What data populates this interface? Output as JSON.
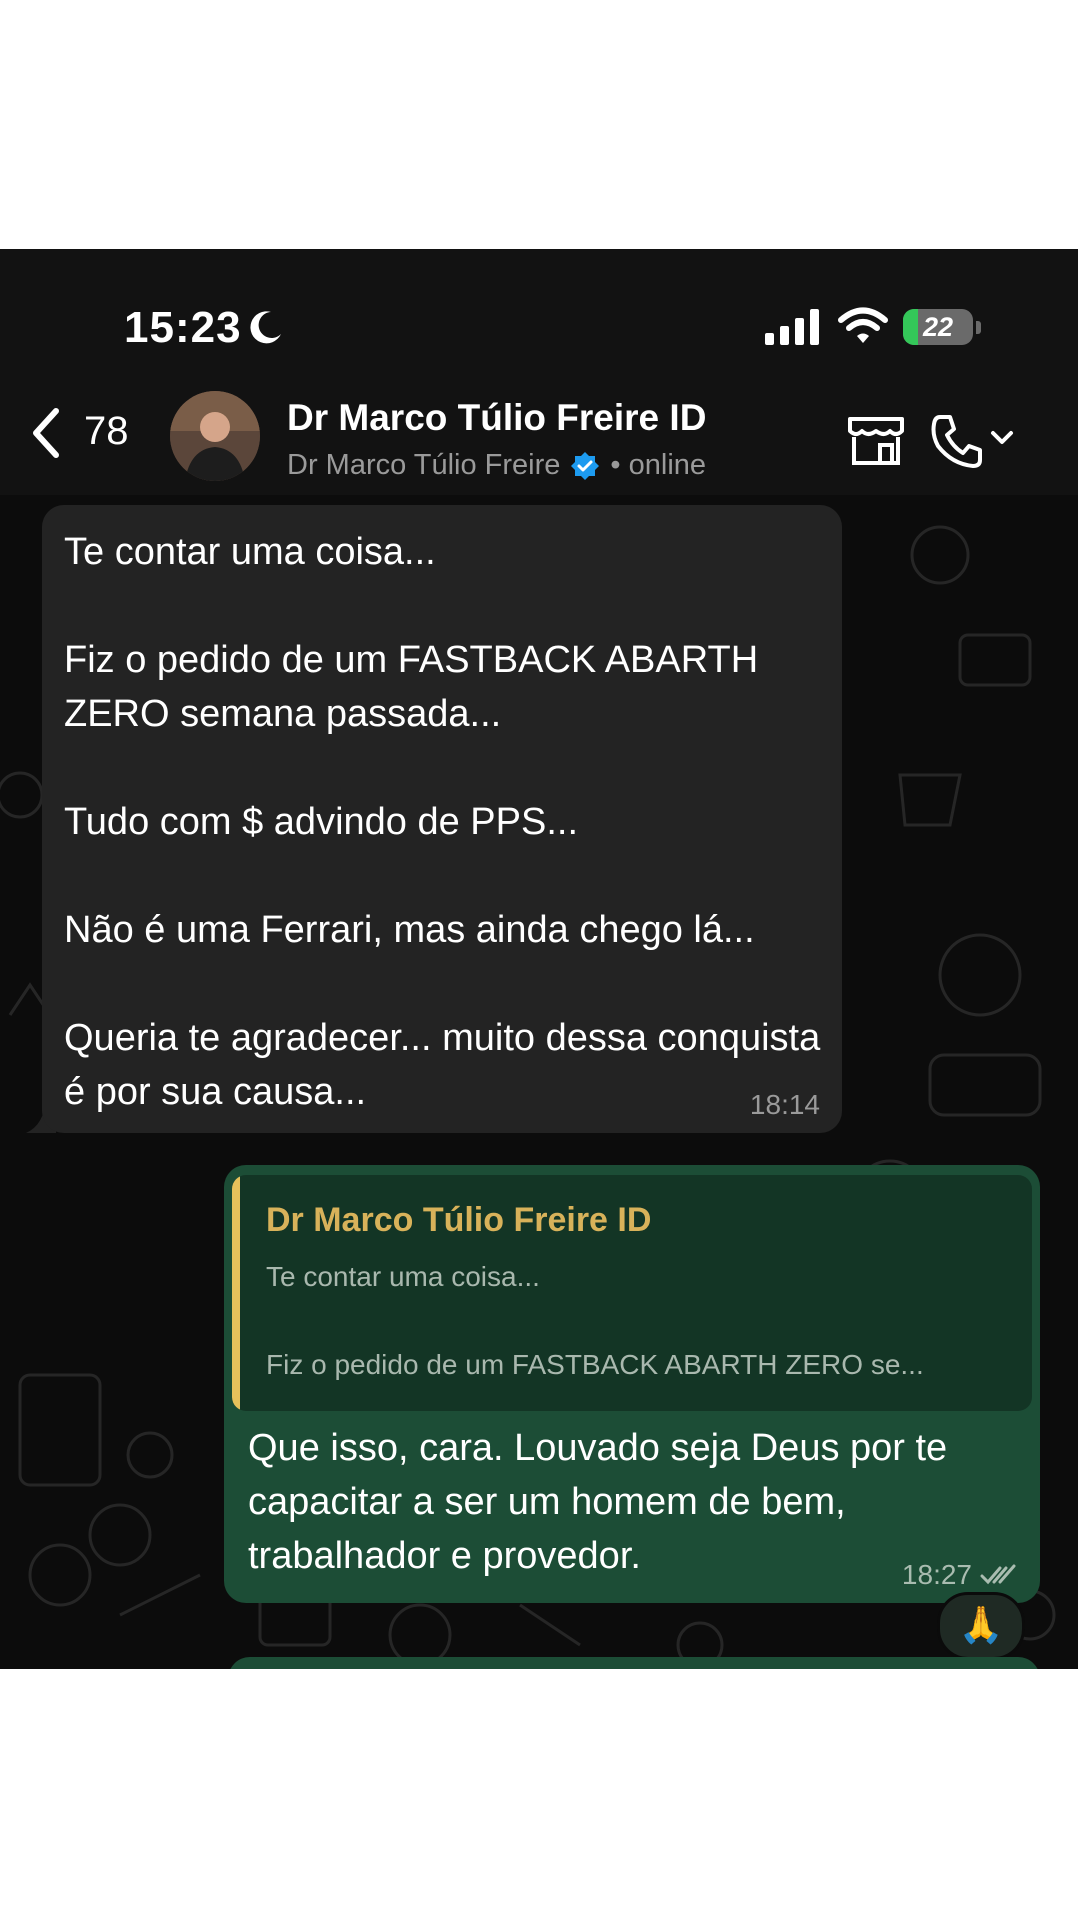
{
  "status": {
    "time": "15:23",
    "battery": "22",
    "battery_level": 0.22
  },
  "header": {
    "back_count": "78",
    "contact_name": "Dr Marco Túlio Freire ID",
    "contact_sub_name": "Dr Marco Túlio Freire",
    "presence": "• online",
    "icons": [
      "chevron-left-icon",
      "verified-badge-icon",
      "store-icon",
      "phone-icon",
      "chevron-down-icon"
    ]
  },
  "messages": [
    {
      "direction": "incoming",
      "text": "Te contar uma coisa...\n\nFiz o pedido de um FASTBACK ABARTH ZERO semana passada...\n\nTudo com $ advindo de PPS...\n\nNão é uma Ferrari, mas ainda chego lá...\n\nQueria te agradecer... muito dessa conquista é por sua causa...",
      "time": "18:14"
    },
    {
      "direction": "outgoing",
      "quote": {
        "name": "Dr Marco Túlio Freire ID",
        "text": "Te contar uma coisa...\n\nFiz o pedido de um FASTBACK ABARTH ZERO se..."
      },
      "text": "Que isso, cara. Louvado seja Deus por te capacitar a ser um homem de bem, trabalhador e provedor.",
      "time": "18:27",
      "reaction": "🙏"
    }
  ],
  "colors": {
    "incoming_bubble": "#232323",
    "outgoing_bubble": "#1c4d36",
    "quote_accent": "#e6c15b",
    "verified": "#1d9bf0"
  }
}
